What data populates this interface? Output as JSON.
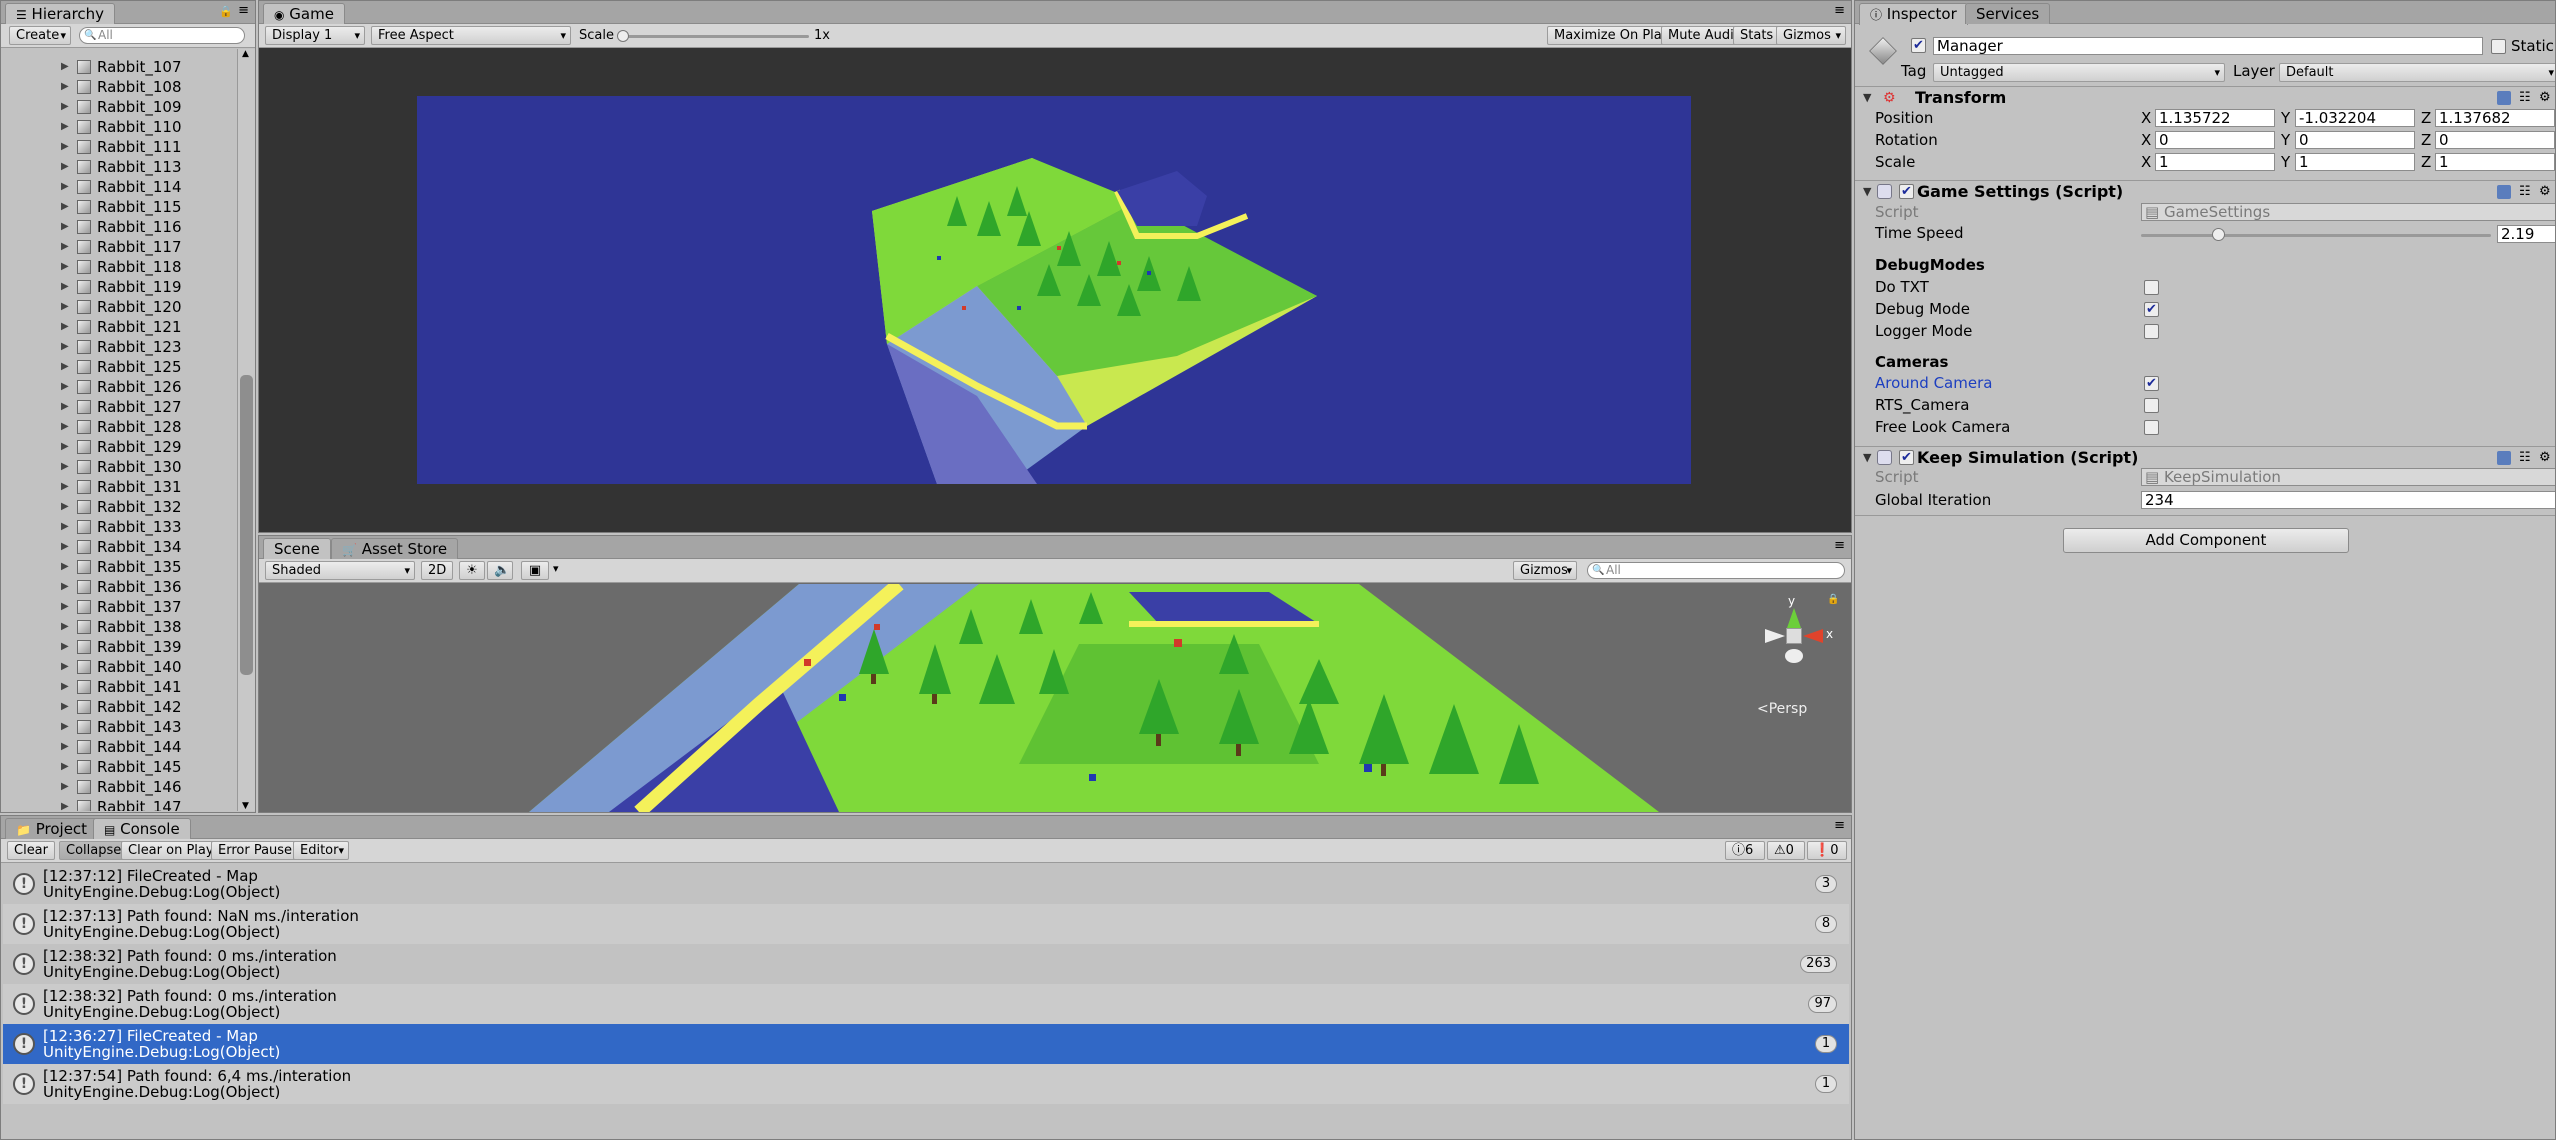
{
  "hierarchy": {
    "tab": "Hierarchy",
    "create_label": "Create",
    "search_placeholder": "All",
    "items": [
      "Rabbit_107",
      "Rabbit_108",
      "Rabbit_109",
      "Rabbit_110",
      "Rabbit_111",
      "Rabbit_113",
      "Rabbit_114",
      "Rabbit_115",
      "Rabbit_116",
      "Rabbit_117",
      "Rabbit_118",
      "Rabbit_119",
      "Rabbit_120",
      "Rabbit_121",
      "Rabbit_123",
      "Rabbit_125",
      "Rabbit_126",
      "Rabbit_127",
      "Rabbit_128",
      "Rabbit_129",
      "Rabbit_130",
      "Rabbit_131",
      "Rabbit_132",
      "Rabbit_133",
      "Rabbit_134",
      "Rabbit_135",
      "Rabbit_136",
      "Rabbit_137",
      "Rabbit_138",
      "Rabbit_139",
      "Rabbit_140",
      "Rabbit_141",
      "Rabbit_142",
      "Rabbit_143",
      "Rabbit_144",
      "Rabbit_145",
      "Rabbit_146",
      "Rabbit_147"
    ],
    "scroll_fraction": 0.72
  },
  "game": {
    "tab": "Game",
    "display": "Display 1",
    "aspect": "Free Aspect",
    "scale_label": "Scale",
    "scale_value": "1x",
    "maximize": "Maximize On Play",
    "mute": "Mute Audio",
    "stats": "Stats",
    "gizmos": "Gizmos"
  },
  "scene": {
    "tab_scene": "Scene",
    "tab_asset": "Asset Store",
    "shaded": "Shaded",
    "mode_2d": "2D",
    "gizmos": "Gizmos",
    "search_placeholder": "All",
    "persp": "<Persp",
    "axis_y": "y",
    "axis_x": "x"
  },
  "console": {
    "tab_project": "Project",
    "tab_console": "Console",
    "buttons": [
      "Clear",
      "Collapse",
      "Clear on Play",
      "Error Pause",
      "Editor"
    ],
    "count_log": "6",
    "count_warn": "0",
    "count_error": "0",
    "rows": [
      {
        "line1": "[12:37:12] FileCreated - Map",
        "line2": "UnityEngine.Debug:Log(Object)",
        "count": "3",
        "selected": false
      },
      {
        "line1": "[12:37:13] Path found: NaN ms./interation",
        "line2": "UnityEngine.Debug:Log(Object)",
        "count": "8",
        "selected": false
      },
      {
        "line1": "[12:38:32] Path found: 0 ms./interation",
        "line2": "UnityEngine.Debug:Log(Object)",
        "count": "263",
        "selected": false
      },
      {
        "line1": "[12:38:32] Path found: 0 ms./interation",
        "line2": "UnityEngine.Debug:Log(Object)",
        "count": "97",
        "selected": false
      },
      {
        "line1": "[12:36:27] FileCreated - Map",
        "line2": "UnityEngine.Debug:Log(Object)",
        "count": "1",
        "selected": true
      },
      {
        "line1": "[12:37:54] Path found: 6,4 ms./interation",
        "line2": "UnityEngine.Debug:Log(Object)",
        "count": "1",
        "selected": false
      }
    ]
  },
  "inspector": {
    "tab_inspector": "Inspector",
    "tab_services": "Services",
    "name": "Manager",
    "static_label": "Static",
    "tag_label": "Tag",
    "tag_value": "Untagged",
    "layer_label": "Layer",
    "layer_value": "Default",
    "transform": {
      "title": "Transform",
      "position_label": "Position",
      "rotation_label": "Rotation",
      "scale_label": "Scale",
      "position": [
        "1.135722",
        "-1.032204",
        "1.137682"
      ],
      "rotation": [
        "0",
        "0",
        "0"
      ],
      "scale": [
        "1",
        "1",
        "1"
      ],
      "x": "X",
      "y": "Y",
      "z": "Z"
    },
    "game_settings": {
      "title": "Game Settings (Script)",
      "script_label": "Script",
      "script_value": "GameSettings",
      "time_speed_label": "Time Speed",
      "time_speed_value": "2.19",
      "time_speed_fraction": 0.22,
      "debug_header": "DebugModes",
      "do_txt": "Do TXT",
      "debug_mode": "Debug Mode",
      "logger_mode": "Logger Mode",
      "cameras_header": "Cameras",
      "around_camera": "Around Camera",
      "rts_camera": "RTS_Camera",
      "free_look": "Free Look Camera"
    },
    "keep_sim": {
      "title": "Keep Simulation (Script)",
      "script_label": "Script",
      "script_value": "KeepSimulation",
      "global_iteration_label": "Global Iteration",
      "global_iteration_value": "234"
    },
    "add_component": "Add Component"
  },
  "colors": {
    "selection": "#3168c6",
    "sky": "#2f3596",
    "grass": "#7fd93a",
    "sand": "#f4f15a",
    "water": "#3a3fa6"
  }
}
